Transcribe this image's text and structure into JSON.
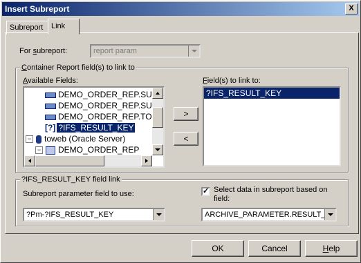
{
  "window": {
    "title": "Insert Subreport",
    "close": "X"
  },
  "tabs": [
    {
      "label": "Subreport"
    },
    {
      "label": "Link"
    }
  ],
  "for_subreport": {
    "label_pre": "For ",
    "label_u": "s",
    "label_post": "ubreport:",
    "value": "report param"
  },
  "container_group": {
    "title_pre": "",
    "title_u": "C",
    "title_post": "ontainer Report field(s) to link to"
  },
  "available": {
    "label_pre": "",
    "label_u": "A",
    "label_post": "vailable Fields:",
    "items": [
      {
        "text": "DEMO_ORDER_REP.SU",
        "icon": "field-icon"
      },
      {
        "text": "DEMO_ORDER_REP.SU",
        "icon": "field-icon"
      },
      {
        "text": "DEMO_ORDER_REP.TO",
        "icon": "field-icon"
      },
      {
        "text": "?IFS_RESULT_KEY",
        "icon": "parameter-icon",
        "icon_text": "[?]"
      },
      {
        "text": "toweb (Oracle Server)",
        "icon": "database-icon"
      },
      {
        "text": "DEMO_ORDER_REP",
        "icon": "table-icon"
      }
    ]
  },
  "buttons": {
    "add": ">",
    "remove": "<",
    "ok": "OK",
    "cancel": "Cancel",
    "help_pre": "",
    "help_u": "H",
    "help_post": "elp"
  },
  "linked": {
    "label_pre": "",
    "label_u": "F",
    "label_post": "ield(s) to link to:",
    "items": [
      "?IFS_RESULT_KEY"
    ]
  },
  "field_link_group": {
    "title": "?IFS_RESULT_KEY field link"
  },
  "subreport_param": {
    "label": "Subreport parameter field to use:",
    "value": "?Pm-?IFS_RESULT_KEY"
  },
  "select_data": {
    "checked": true,
    "label_line1": "Select data in subreport based on",
    "label_line2": "field:",
    "value": "ARCHIVE_PARAMETER.RESULT_I"
  }
}
